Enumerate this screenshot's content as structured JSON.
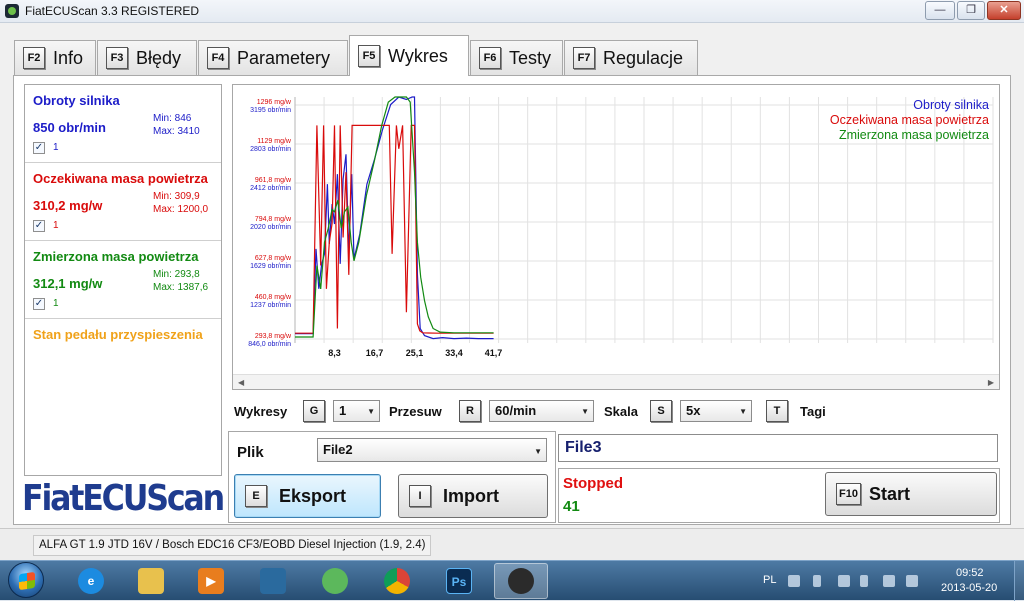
{
  "window": {
    "title": "FiatECUScan 3.3 REGISTERED",
    "minimize_glyph": "—",
    "restore_glyph": "❐",
    "close_glyph": "✕"
  },
  "tabs": [
    {
      "key": "F2",
      "label": "Info"
    },
    {
      "key": "F3",
      "label": "Błędy"
    },
    {
      "key": "F4",
      "label": "Parametery"
    },
    {
      "key": "F5",
      "label": "Wykres"
    },
    {
      "key": "F6",
      "label": "Testy"
    },
    {
      "key": "F7",
      "label": "Regulacje"
    }
  ],
  "active_tab": "Wykres",
  "parameters": [
    {
      "name": "Obroty silnika",
      "value": "850 obr/min",
      "min": "Min: 846",
      "max": "Max: 3410",
      "checked_glyph": "✓",
      "num": "1",
      "color": "#1c1cc8"
    },
    {
      "name": "Oczekiwana masa powietrza",
      "value": "310,2 mg/w",
      "min": "Min: 309,9",
      "max": "Max: 1200,0",
      "checked_glyph": "✓",
      "num": "1",
      "color": "#d90b0b"
    },
    {
      "name": "Zmierzona masa powietrza",
      "value": "312,1 mg/w",
      "min": "Min: 293,8",
      "max": "Max: 1387,6",
      "checked_glyph": "✓",
      "num": "1",
      "color": "#128a12"
    },
    {
      "name": "Stan pedału przyspieszenia",
      "color": "#f0a21a"
    }
  ],
  "logo_text": "FiatECUScan",
  "chart_data": {
    "type": "line",
    "x_ticks": [
      "8,3",
      "16,7",
      "25,1",
      "33,4",
      "41,7"
    ],
    "x_range": [
      0,
      42
    ],
    "y_ticks_left": [
      {
        "air": "1296 mg/w",
        "rpm": "3195 obr/min"
      },
      {
        "air": "1129 mg/w",
        "rpm": "2803 obr/min"
      },
      {
        "air": "961,8 mg/w",
        "rpm": "2412 obr/min"
      },
      {
        "air": "794,8 mg/w",
        "rpm": "2020 obr/min"
      },
      {
        "air": "627,8 mg/w",
        "rpm": "1629 obr/min"
      },
      {
        "air": "460,8 mg/w",
        "rpm": "1237 obr/min"
      },
      {
        "air": "293,8 mg/w",
        "rpm": "846,0 obr/min"
      }
    ],
    "legend_position": "top-right",
    "grid": true,
    "series": [
      {
        "name": "Obroty silnika",
        "color": "#1c1cc8",
        "unit": "obr/min",
        "x": [
          0,
          3.8,
          4.4,
          5.0,
          5.6,
          6.2,
          6.8,
          7.2,
          7.8,
          8.3,
          8.9,
          9.5,
          10.1,
          10.7,
          11.3,
          11.9,
          12.4,
          13.6,
          15.1,
          16.7,
          18.4,
          20.1,
          21.8,
          23.4,
          24.6,
          25.1,
          25.7,
          26.3,
          27.2,
          29.0,
          31.0,
          33.4,
          36.0,
          38.5,
          41.7
        ],
        "y": [
          900,
          900,
          1750,
          1350,
          1600,
          1700,
          2400,
          1800,
          2200,
          2000,
          2500,
          1600,
          2450,
          2700,
          1700,
          2500,
          1650,
          1900,
          2400,
          2650,
          2950,
          3200,
          3370,
          3250,
          3370,
          3410,
          1500,
          950,
          880,
          850,
          860,
          850,
          855,
          850,
          850
        ]
      },
      {
        "name": "Oczekiwana masa powietrza",
        "color": "#d90b0b",
        "unit": "mg/w",
        "x": [
          0,
          3.8,
          4.6,
          5.4,
          6.0,
          6.6,
          7.2,
          7.8,
          8.3,
          8.9,
          9.5,
          10.1,
          10.7,
          11.3,
          12.0,
          12.6,
          14.0,
          16.7,
          19.8,
          20.4,
          21.3,
          21.8,
          22.6,
          23.4,
          24.4,
          25.1,
          25.7,
          26.2,
          26.8,
          28.0,
          30.0,
          33.4,
          36.5,
          41.7
        ],
        "y": [
          310,
          310,
          1200,
          600,
          1200,
          500,
          700,
          780,
          1200,
          330,
          1200,
          720,
          1000,
          560,
          1200,
          1200,
          1200,
          1200,
          1200,
          650,
          1200,
          1100,
          1200,
          400,
          1200,
          1200,
          350,
          320,
          312,
          311,
          310,
          310,
          310,
          310
        ]
      },
      {
        "name": "Zmierzona masa powietrza",
        "color": "#128a12",
        "unit": "mg/w",
        "x": [
          0,
          3.8,
          4.6,
          5.4,
          6.2,
          7.0,
          7.8,
          8.3,
          9.0,
          9.7,
          10.4,
          11.1,
          11.8,
          12.4,
          13.4,
          15.0,
          16.7,
          18.2,
          19.6,
          21.0,
          22.1,
          23.4,
          24.2,
          25.1,
          25.7,
          26.4,
          27.2,
          28.0,
          29.0,
          30.5,
          33.4,
          36.5,
          41.7
        ],
        "y": [
          294,
          294,
          600,
          500,
          700,
          760,
          840,
          830,
          880,
          760,
          830,
          850,
          700,
          620,
          700,
          900,
          1050,
          1200,
          1300,
          1360,
          1387,
          1340,
          1300,
          1000,
          700,
          550,
          450,
          380,
          330,
          315,
          312,
          312,
          312
        ]
      }
    ]
  },
  "controls": {
    "wykresy_label": "Wykresy",
    "wykresy_key": "G",
    "wykresy_value": "1",
    "przesuw_label": "Przesuw",
    "przesuw_key": "R",
    "przesuw_value": "60/min",
    "skala_label": "Skala",
    "skala_key": "S",
    "skala_value": "5x",
    "tagi_key": "T",
    "tagi_label": "Tagi",
    "dropdown_arrow": "▼"
  },
  "file_panel": {
    "label": "Plik",
    "value": "File2",
    "export_key": "E",
    "export_label": "Eksport",
    "import_key": "I",
    "import_label": "Import"
  },
  "run_panel": {
    "file": "File3",
    "status": "Stopped",
    "count": "41",
    "start_key": "F10",
    "start_label": "Start"
  },
  "statusbar": {
    "text": "ALFA GT 1.9 JTD 16V / Bosch EDC16 CF3/EOBD Diesel Injection (1.9, 2.4)"
  },
  "taskbar": {
    "lang": "PL",
    "time": "09:52",
    "date": "2013-05-20",
    "ps_label": "Ps"
  }
}
